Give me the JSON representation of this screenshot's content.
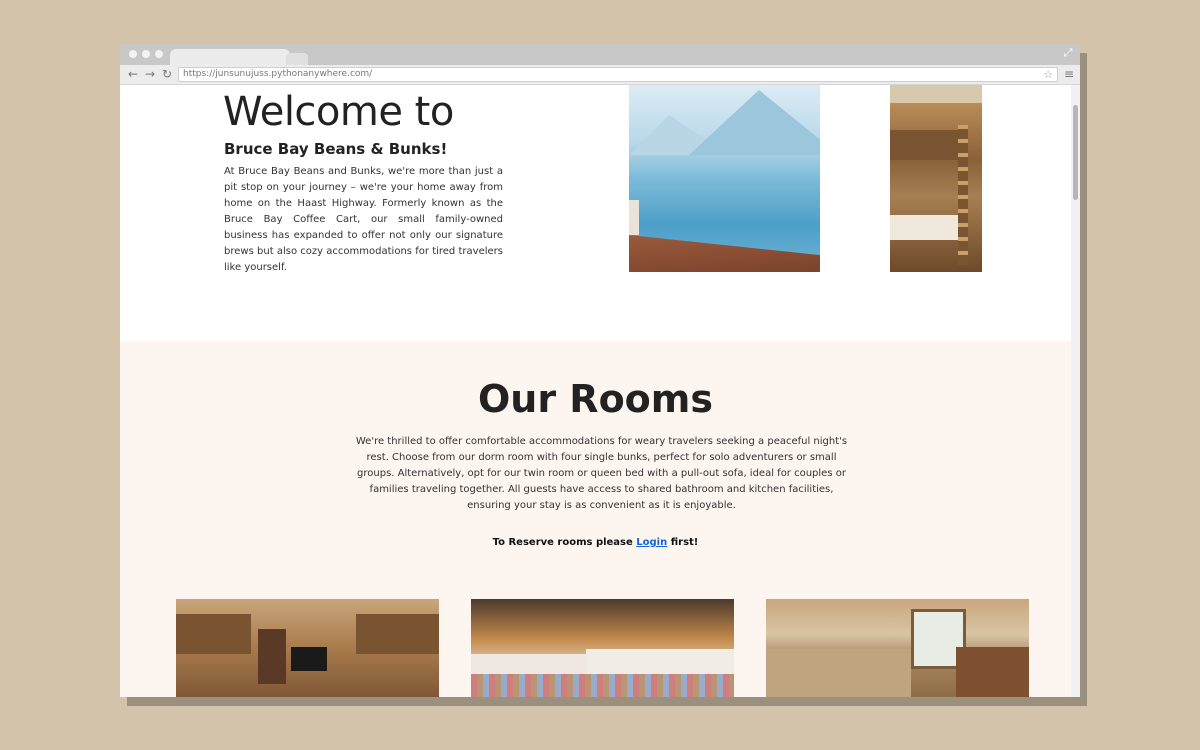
{
  "browser": {
    "url": "https://junsunujuss.pythonanywhere.com/",
    "icons": {
      "back": "←",
      "forward": "→",
      "reload": "↻",
      "bookmark": "☆",
      "menu": "≡",
      "fullscreen": "⤢"
    }
  },
  "hero": {
    "title": "Welcome to",
    "subtitle": "Bruce Bay Beans & Bunks!",
    "paragraph": "At Bruce Bay Beans and Bunks, we're more than just a pit stop on your journey – we're your home away from home on the Haast Highway. Formerly known as the Bruce Bay Coffee Cart, our small family-owned business has expanded to offer not only our signature brews but also cozy accommodations for tired travelers like yourself."
  },
  "rooms": {
    "title": "Our Rooms",
    "paragraph": "We're thrilled to offer comfortable accommodations for weary travelers seeking a peaceful night's rest. Choose from our dorm room with four single bunks, perfect for solo adventurers or small groups. Alternatively, opt for our twin room or queen bed with a pull-out sofa, ideal for couples or families traveling together. All guests have access to shared bathroom and kitchen facilities, ensuring your stay is as convenient as it is enjoyable.",
    "reserve_prefix": "To Reserve rooms please",
    "login_link": "Login",
    "reserve_suffix": "first!"
  },
  "colors": {
    "page_background": "#d3c3ab",
    "rooms_background": "#fdf5f0",
    "link": "#1565d8"
  }
}
